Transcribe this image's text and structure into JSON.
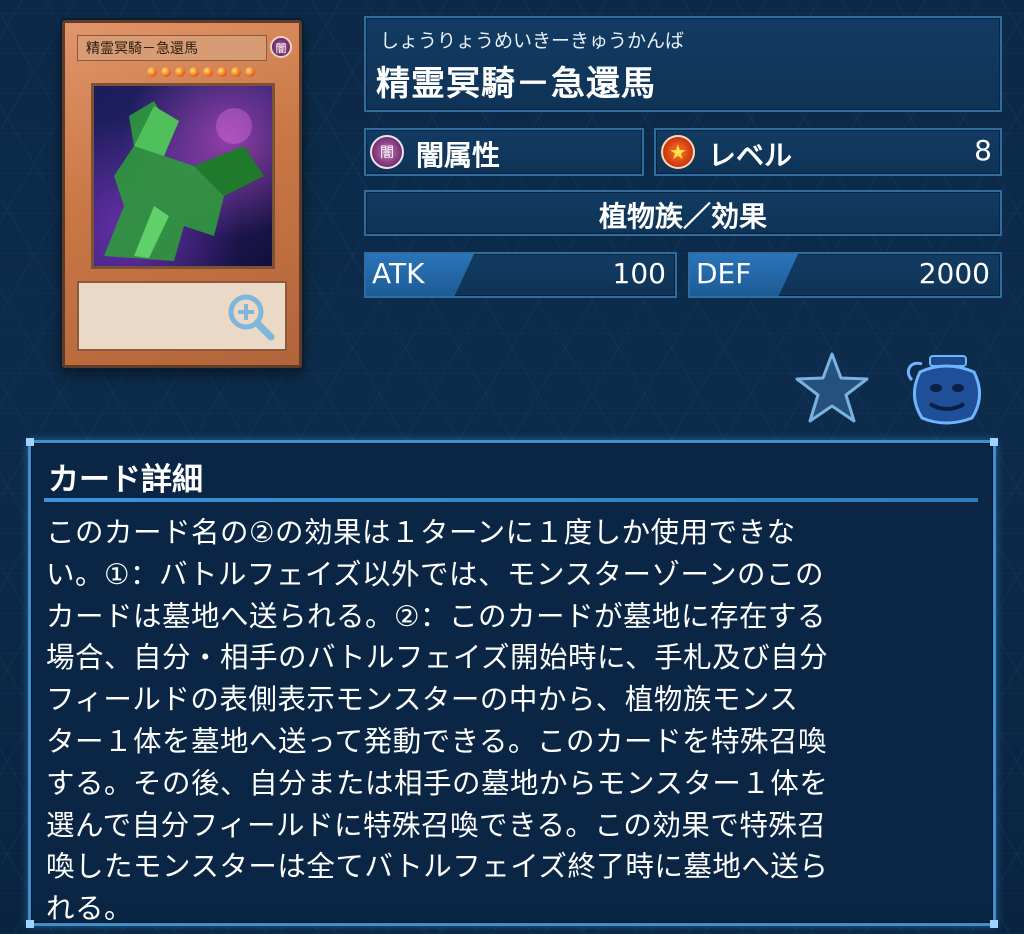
{
  "card_image": {
    "name": "精霊冥騎－急還馬",
    "attribute_glyph": "闇",
    "stars": 8
  },
  "info": {
    "furigana": "しょうりょうめいきーきゅうかんば",
    "name": "精霊冥騎－急還馬",
    "attribute_glyph": "闇",
    "attribute": "闇属性",
    "level_label": "レベル",
    "level": "8",
    "type": "植物族／効果",
    "atk_label": "ATK",
    "atk": "100",
    "def_label": "DEF",
    "def": "2000"
  },
  "actions": {
    "favorite_icon": "star-icon",
    "deck_icon": "pot-icon"
  },
  "detail": {
    "title": "カード詳細",
    "text_lines": [
      "このカード名の②の効果は１ターンに１度しか使用できな",
      "い。①：バトルフェイズ以外では、モンスターゾーンのこの",
      "カードは墓地へ送られる。②：このカードが墓地に存在する",
      "場合、自分・相手のバトルフェイズ開始時に、手札及び自分",
      "フィールドの表側表示モンスターの中から、植物族モンス",
      "ター１体を墓地へ送って発動できる。このカードを特殊召喚",
      "する。その後、自分または相手の墓地からモンスター１体を",
      "選んで自分フィールドに特殊召喚できる。この効果で特殊召",
      "喚したモンスターは全てバトルフェイズ終了時に墓地へ送ら",
      "れる。"
    ]
  },
  "colors": {
    "background": "#0c2a48",
    "panel_border": "#2f6da1",
    "accent": "#3c8fd0"
  }
}
